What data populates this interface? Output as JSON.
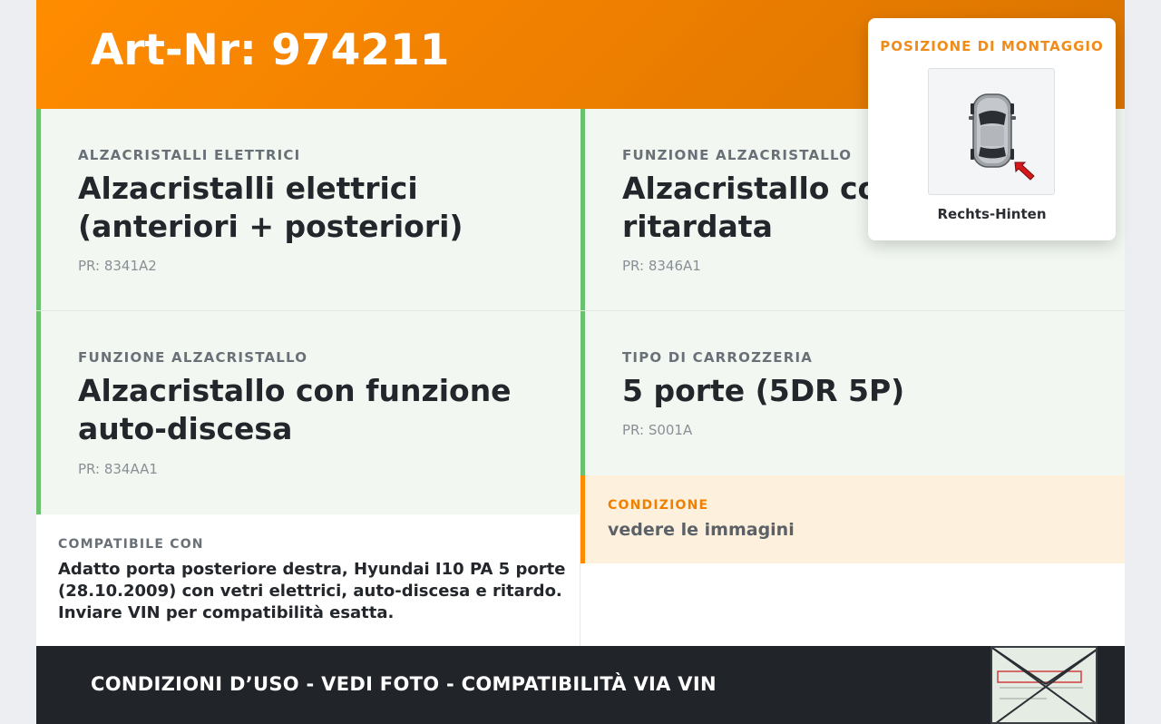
{
  "header": {
    "title": "Art-Nr: 974211"
  },
  "cards": [
    {
      "label": "ALZACRISTALLI ELETTRICI",
      "value_line1": "Alzacristalli elettrici",
      "value_line2": "(anteriori + posteriori)",
      "pr": "PR: 8341A2"
    },
    {
      "label": "FUNZIONE ALZACRISTALLO",
      "value_line1": "Alzacristallo con funzione",
      "value_line2": "ritardata",
      "pr": "PR: 8346A1"
    },
    {
      "label": "FUNZIONE ALZACRISTALLO",
      "value_line1": "Alzacristallo con funzione",
      "value_line2": "auto-discesa",
      "pr": "PR: 834AA1"
    },
    {
      "label": "TIPO DI CARROZZERIA",
      "value_line1": "5 porte (5DR 5P)",
      "pr": "PR: S001A"
    }
  ],
  "condition": {
    "label": "CONDIZIONE",
    "value": "vedere le immagini"
  },
  "compat": {
    "label": "COMPATIBILE CON",
    "line1": "Adatto porta posteriore destra, Hyundai I10 PA 5 porte",
    "line2": "(28.10.2009) con vetri elettrici, auto-discesa e ritardo.",
    "line3": "Inviare VIN per compatibilità esatta."
  },
  "footer": {
    "text": "CONDIZIONI D’USO - VEDI FOTO - COMPATIBILITÀ VIA VIN"
  },
  "position": {
    "title": "POSIZIONE DI MONTAGGIO",
    "caption": "Rechts-Hinten",
    "icon": "car-top-view-icon",
    "arrow_color": "#d4191c"
  },
  "colors": {
    "accent": "#ff8c00",
    "green": "#6cc16f",
    "dark": "#212429"
  }
}
